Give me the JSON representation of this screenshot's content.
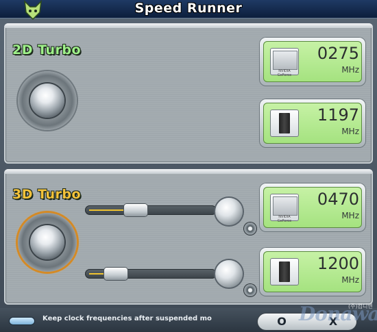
{
  "window": {
    "title": "Speed Runner"
  },
  "turbo2d": {
    "label": "2D Turbo",
    "core": {
      "value": "0275",
      "unit": "MHz",
      "chip_text": "NVIDIA GeForce"
    },
    "memory": {
      "value": "1197",
      "unit": "MHz"
    }
  },
  "turbo3d": {
    "label": "3D Turbo",
    "core": {
      "value": "0470",
      "unit": "MHz",
      "chip_text": "NVIDIA GeForce",
      "slider_level": 0.35
    },
    "memory": {
      "value": "1200",
      "unit": "MHz",
      "slider_level": 0.15
    }
  },
  "footer": {
    "keep_clock_text": "Keep clock frequencies after suspended mo",
    "ok_label": "O",
    "close_label": "X"
  },
  "watermark": {
    "text": "Donawa",
    "small": "(주)컴디앤"
  },
  "colors": {
    "label_2d": "#9ff08a",
    "label_3d": "#f3c23a",
    "lcd": "#b8ec92"
  }
}
